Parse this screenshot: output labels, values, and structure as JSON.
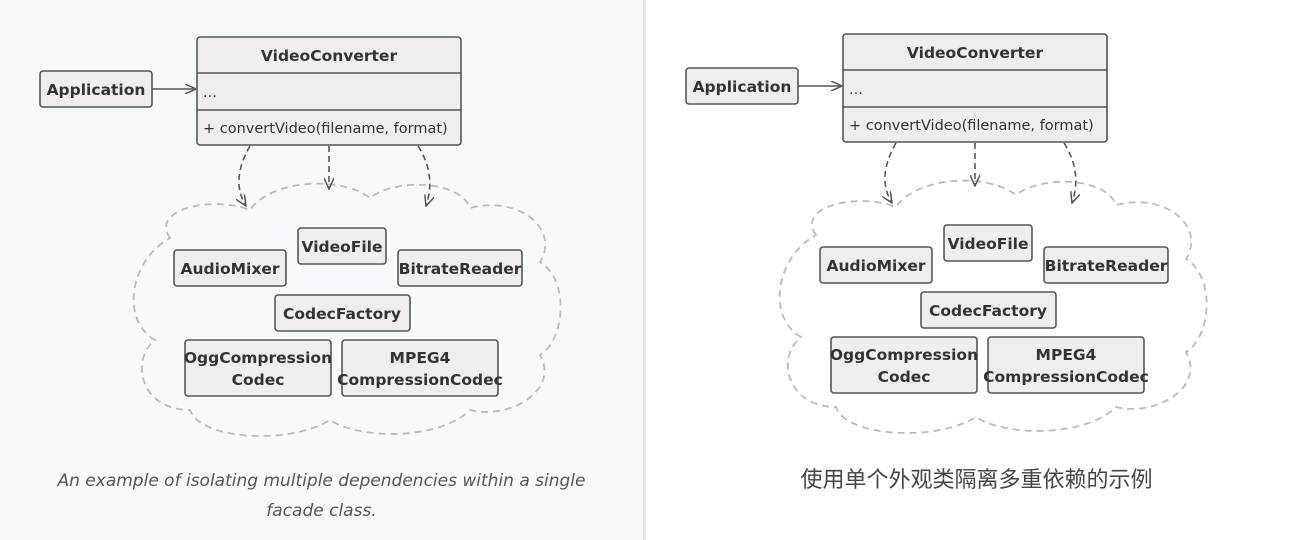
{
  "panels": [
    {
      "app": "Application",
      "class_title": "VideoConverter",
      "class_fields": "...",
      "class_method": "+ convertVideo(filename, format)",
      "subsystem": {
        "audio_mixer": "AudioMixer",
        "video_file": "VideoFile",
        "bitrate_reader": "BitrateReader",
        "codec_factory": "CodecFactory",
        "ogg_line1": "OggCompression",
        "ogg_line2": "Codec",
        "mpeg_line1": "MPEG4",
        "mpeg_line2": "CompressionCodec"
      },
      "caption": "An example of isolating multiple dependencies within a single facade class."
    },
    {
      "app": "Application",
      "class_title": "VideoConverter",
      "class_fields": "...",
      "class_method": "+ convertVideo(filename, format)",
      "subsystem": {
        "audio_mixer": "AudioMixer",
        "video_file": "VideoFile",
        "bitrate_reader": "BitrateReader",
        "codec_factory": "CodecFactory",
        "ogg_line1": "OggCompression",
        "ogg_line2": "Codec",
        "mpeg_line1": "MPEG4",
        "mpeg_line2": "CompressionCodec"
      },
      "caption": "使用单个外观类隔离多重依赖的示例"
    }
  ],
  "colors": {
    "box_fill": "#eeeeee",
    "box_stroke": "#555555",
    "cloud_stroke": "#bbbbbb",
    "arrow": "#555555"
  }
}
